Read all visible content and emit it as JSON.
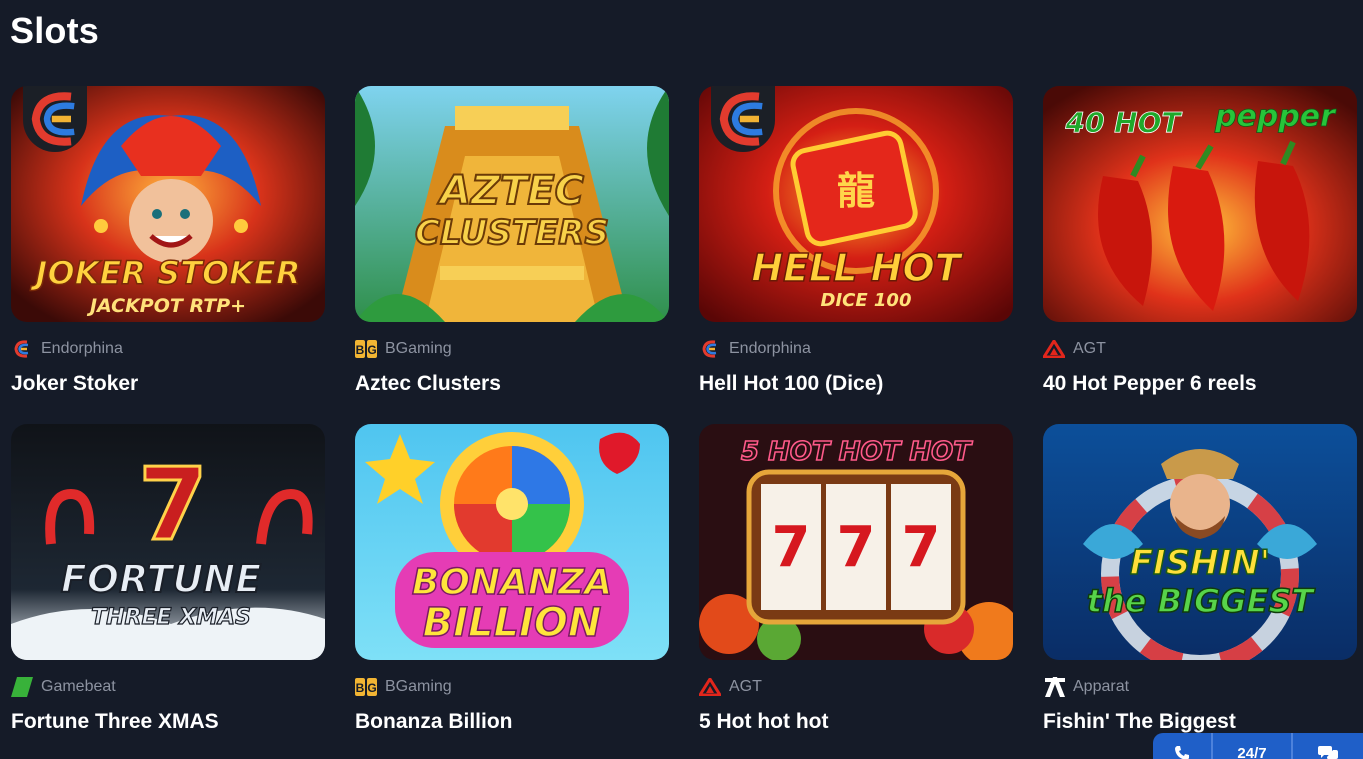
{
  "page": {
    "title": "Slots"
  },
  "games": [
    {
      "name": "Joker Stoker",
      "provider": "Endorphina",
      "provider_icon": "endorphina-icon",
      "art_title": "JOKER STOKER",
      "art_subtitle": "JACKPOT RTP+"
    },
    {
      "name": "Aztec Clusters",
      "provider": "BGaming",
      "provider_icon": "bgaming-icon",
      "art_title": "AZTEC",
      "art_subtitle": "CLUSTERS"
    },
    {
      "name": "Hell Hot 100 (Dice)",
      "provider": "Endorphina",
      "provider_icon": "endorphina-icon",
      "art_title": "HELL HOT",
      "art_subtitle": "DICE 100"
    },
    {
      "name": "40 Hot Pepper 6 reels",
      "provider": "AGT",
      "provider_icon": "agt-icon",
      "art_title": "40 HOT",
      "art_subtitle": "pepper"
    },
    {
      "name": "Fortune Three XMAS",
      "provider": "Gamebeat",
      "provider_icon": "gamebeat-icon",
      "art_title": "FORTUNE",
      "art_subtitle": "THREE XMAS"
    },
    {
      "name": "Bonanza Billion",
      "provider": "BGaming",
      "provider_icon": "bgaming-icon",
      "art_title": "BONANZA",
      "art_subtitle": "BILLION"
    },
    {
      "name": "5 Hot hot hot",
      "provider": "AGT",
      "provider_icon": "agt-icon",
      "art_title": "5 HOT HOT HOT",
      "art_subtitle": "777"
    },
    {
      "name": "Fishin' The Biggest",
      "provider": "Apparat",
      "provider_icon": "apparat-icon",
      "art_title": "FISHIN'",
      "art_subtitle": "the BIGGEST"
    }
  ],
  "support": {
    "phone_icon": "phone-icon",
    "label": "24/7",
    "chat_icon": "chat-icon"
  },
  "colors": {
    "background": "#151b28",
    "provider_text": "#8d93a1",
    "support_bar": "#1f5fc8"
  }
}
